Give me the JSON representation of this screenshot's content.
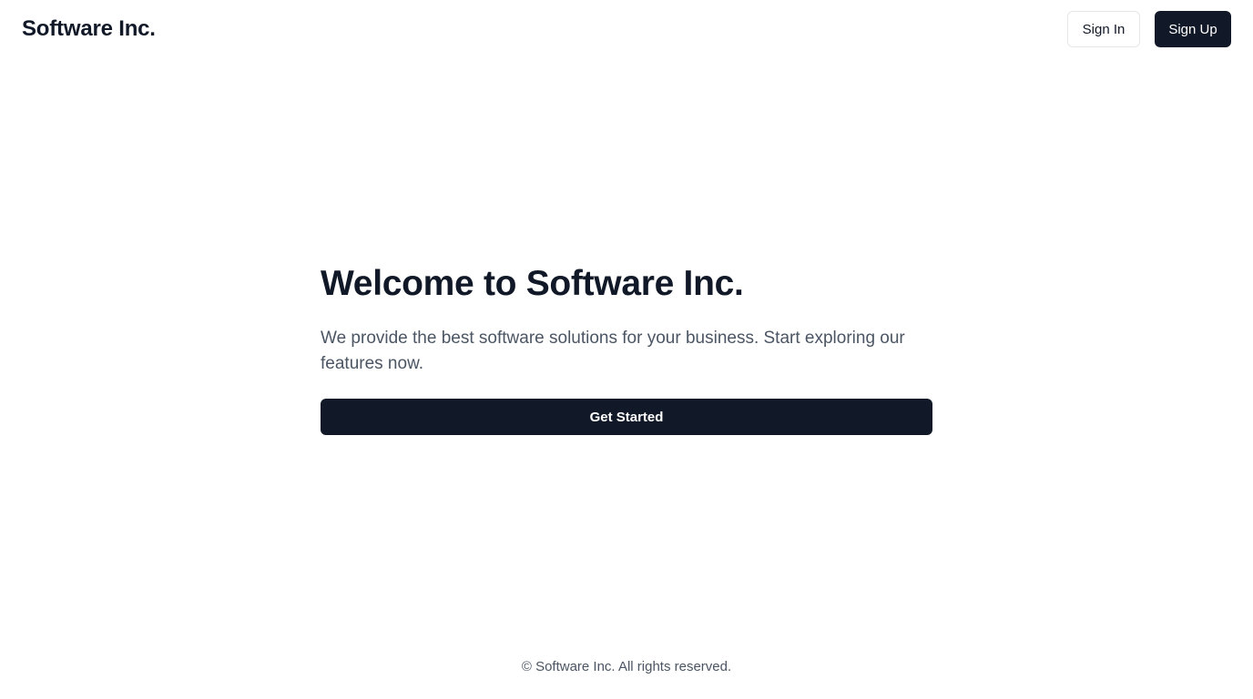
{
  "header": {
    "brand": "Software Inc.",
    "sign_in_label": "Sign In",
    "sign_up_label": "Sign Up"
  },
  "hero": {
    "title": "Welcome to Software Inc.",
    "description": "We provide the best software solutions for your business. Start exploring our features now.",
    "cta_label": "Get Started"
  },
  "footer": {
    "copyright": "© Software Inc. All rights reserved."
  },
  "colors": {
    "primary": "#111827",
    "text_muted": "#4b5563",
    "border": "#e5e7eb",
    "background": "#ffffff"
  }
}
